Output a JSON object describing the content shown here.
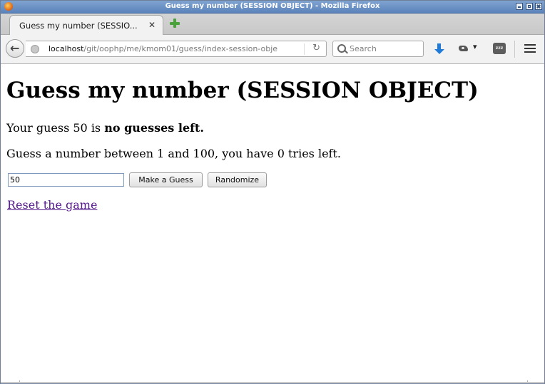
{
  "window": {
    "title": "Guess my number (SESSION OBJECT) - Mozilla Firefox"
  },
  "tab": {
    "label": "Guess my number (SESSIO...",
    "close_glyph": "✕"
  },
  "navbar": {
    "url_host": "localhost",
    "url_path": "/git/oophp/me/kmom01/guess/index-session-obje",
    "search_placeholder": "Search",
    "zzz_label": "zzz"
  },
  "page": {
    "heading": "Guess my number (SESSION OBJECT)",
    "result_prefix": "Your guess 50 is ",
    "result_bold": "no guesses left.",
    "instructions": "Guess a number between 1 and 100, you have 0 tries left.",
    "guess_value": "50",
    "make_guess_label": "Make a Guess",
    "randomize_label": "Randomize",
    "reset_link": "Reset the game"
  },
  "icons": {
    "firefox": "firefox-logo-icon",
    "back": "back-arrow-icon",
    "globe": "globe-icon",
    "reload": "reload-icon",
    "search": "search-icon",
    "download": "download-arrow-icon",
    "addon": "addon-icon",
    "zzz": "sleep-icon",
    "menu": "hamburger-menu-icon",
    "newtab": "new-tab-plus-icon"
  },
  "colors": {
    "titlebar": "#5b83bb",
    "link_visited": "#551a8b",
    "download": "#1f7ad8",
    "newtab_plus": "#4aa33a"
  }
}
